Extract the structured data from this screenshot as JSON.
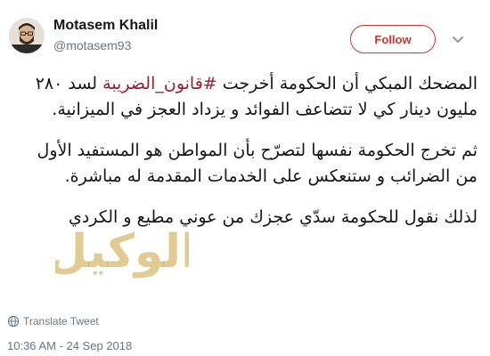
{
  "author": {
    "name": "Motasem Khalil",
    "handle": "@motasem93"
  },
  "follow_button": {
    "label": "Follow",
    "color": "#c7372c"
  },
  "tweet": {
    "p1_before": "المضحك المبكي أن الحكومة أخرجت ",
    "p1_hashtag": "#قانون_الضريبة",
    "p1_after": " لسد ٢٨٠ مليون دينار كي لا تتضاعف الفوائد و يزداد العجز في الميزانية.",
    "p2": "ثم تخرج الحكومة نفسها لتصرّح بأن المواطن هو المستفيد الأول من الضرائب و ستنعكس على الخدمات المقدمة له مباشرة.",
    "p3": "لذلك نقول للحكومة سدّي عجزك من عوني مطيع و الكردي"
  },
  "watermark": {
    "text": "الوكيل"
  },
  "translate_label": "Translate Tweet",
  "timestamp": "10:36 AM - 24 Sep 2018",
  "colors": {
    "hashtag": "#9b1d2c",
    "muted": "#657786",
    "watermark_gold": "#c9a13b"
  },
  "icons": {
    "chevron": "chevron-down-icon",
    "globe": "globe-icon"
  }
}
